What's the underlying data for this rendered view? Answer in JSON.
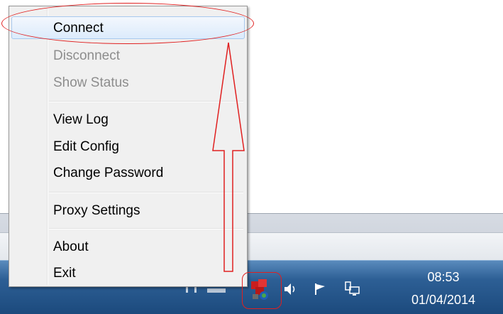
{
  "menu": {
    "items": [
      {
        "label": "Connect",
        "state": "hover"
      },
      {
        "label": "Disconnect",
        "state": "disabled"
      },
      {
        "label": "Show Status",
        "state": "disabled"
      },
      {
        "label": "View Log",
        "state": "enabled"
      },
      {
        "label": "Edit Config",
        "state": "enabled"
      },
      {
        "label": "Change Password",
        "state": "enabled"
      },
      {
        "label": "Proxy Settings",
        "state": "enabled"
      },
      {
        "label": "About",
        "state": "enabled"
      },
      {
        "label": "Exit",
        "state": "enabled"
      }
    ]
  },
  "tray": {
    "icons": [
      "openvpn-tray-icon",
      "volume-icon",
      "action-center-flag-icon",
      "network-icon"
    ],
    "clock": {
      "time": "08:53",
      "date": "01/04/2014"
    }
  },
  "colors": {
    "annotation": "#e02020",
    "taskbar": "#2d5f95",
    "hover": "#dcebfc"
  }
}
